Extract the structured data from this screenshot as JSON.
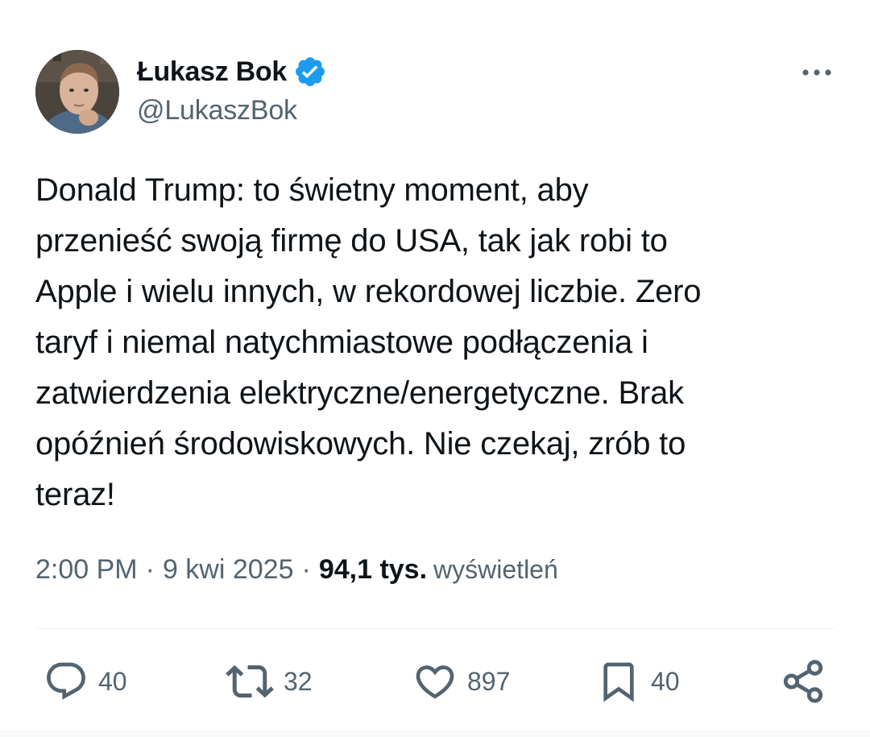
{
  "author": {
    "display_name": "Łukasz Bok",
    "handle": "@LukaszBok",
    "verified": true
  },
  "tweet": {
    "text": "Donald Trump: to świetny moment, aby\nprzenieść swoją firmę do USA, tak jak robi to\nApple i wielu innych, w rekordowej liczbie. Zero\ntaryf i niemal natychmiastowe podłączenia i\nzatwierdzenia elektryczne/energetyczne. Brak\nopóźnień środowiskowych. Nie czekaj, zrób to\nteraz!",
    "time": "2:00 PM",
    "date": "9 kwi 2025",
    "separator": "·",
    "views_count": "94,1 tys.",
    "views_label": "wyświetleń"
  },
  "actions": {
    "replies": "40",
    "reposts": "32",
    "likes": "897",
    "bookmarks": "40"
  },
  "icons": {
    "verified": "verified-badge-icon",
    "more": "more-horizontal-icon",
    "reply": "reply-icon",
    "repost": "repost-icon",
    "like": "heart-icon",
    "bookmark": "bookmark-icon",
    "share": "share-icon"
  },
  "colors": {
    "text_primary": "#0f1419",
    "text_secondary": "#536471",
    "verified_blue": "#1d9bf0",
    "divider": "#eff3f4"
  }
}
